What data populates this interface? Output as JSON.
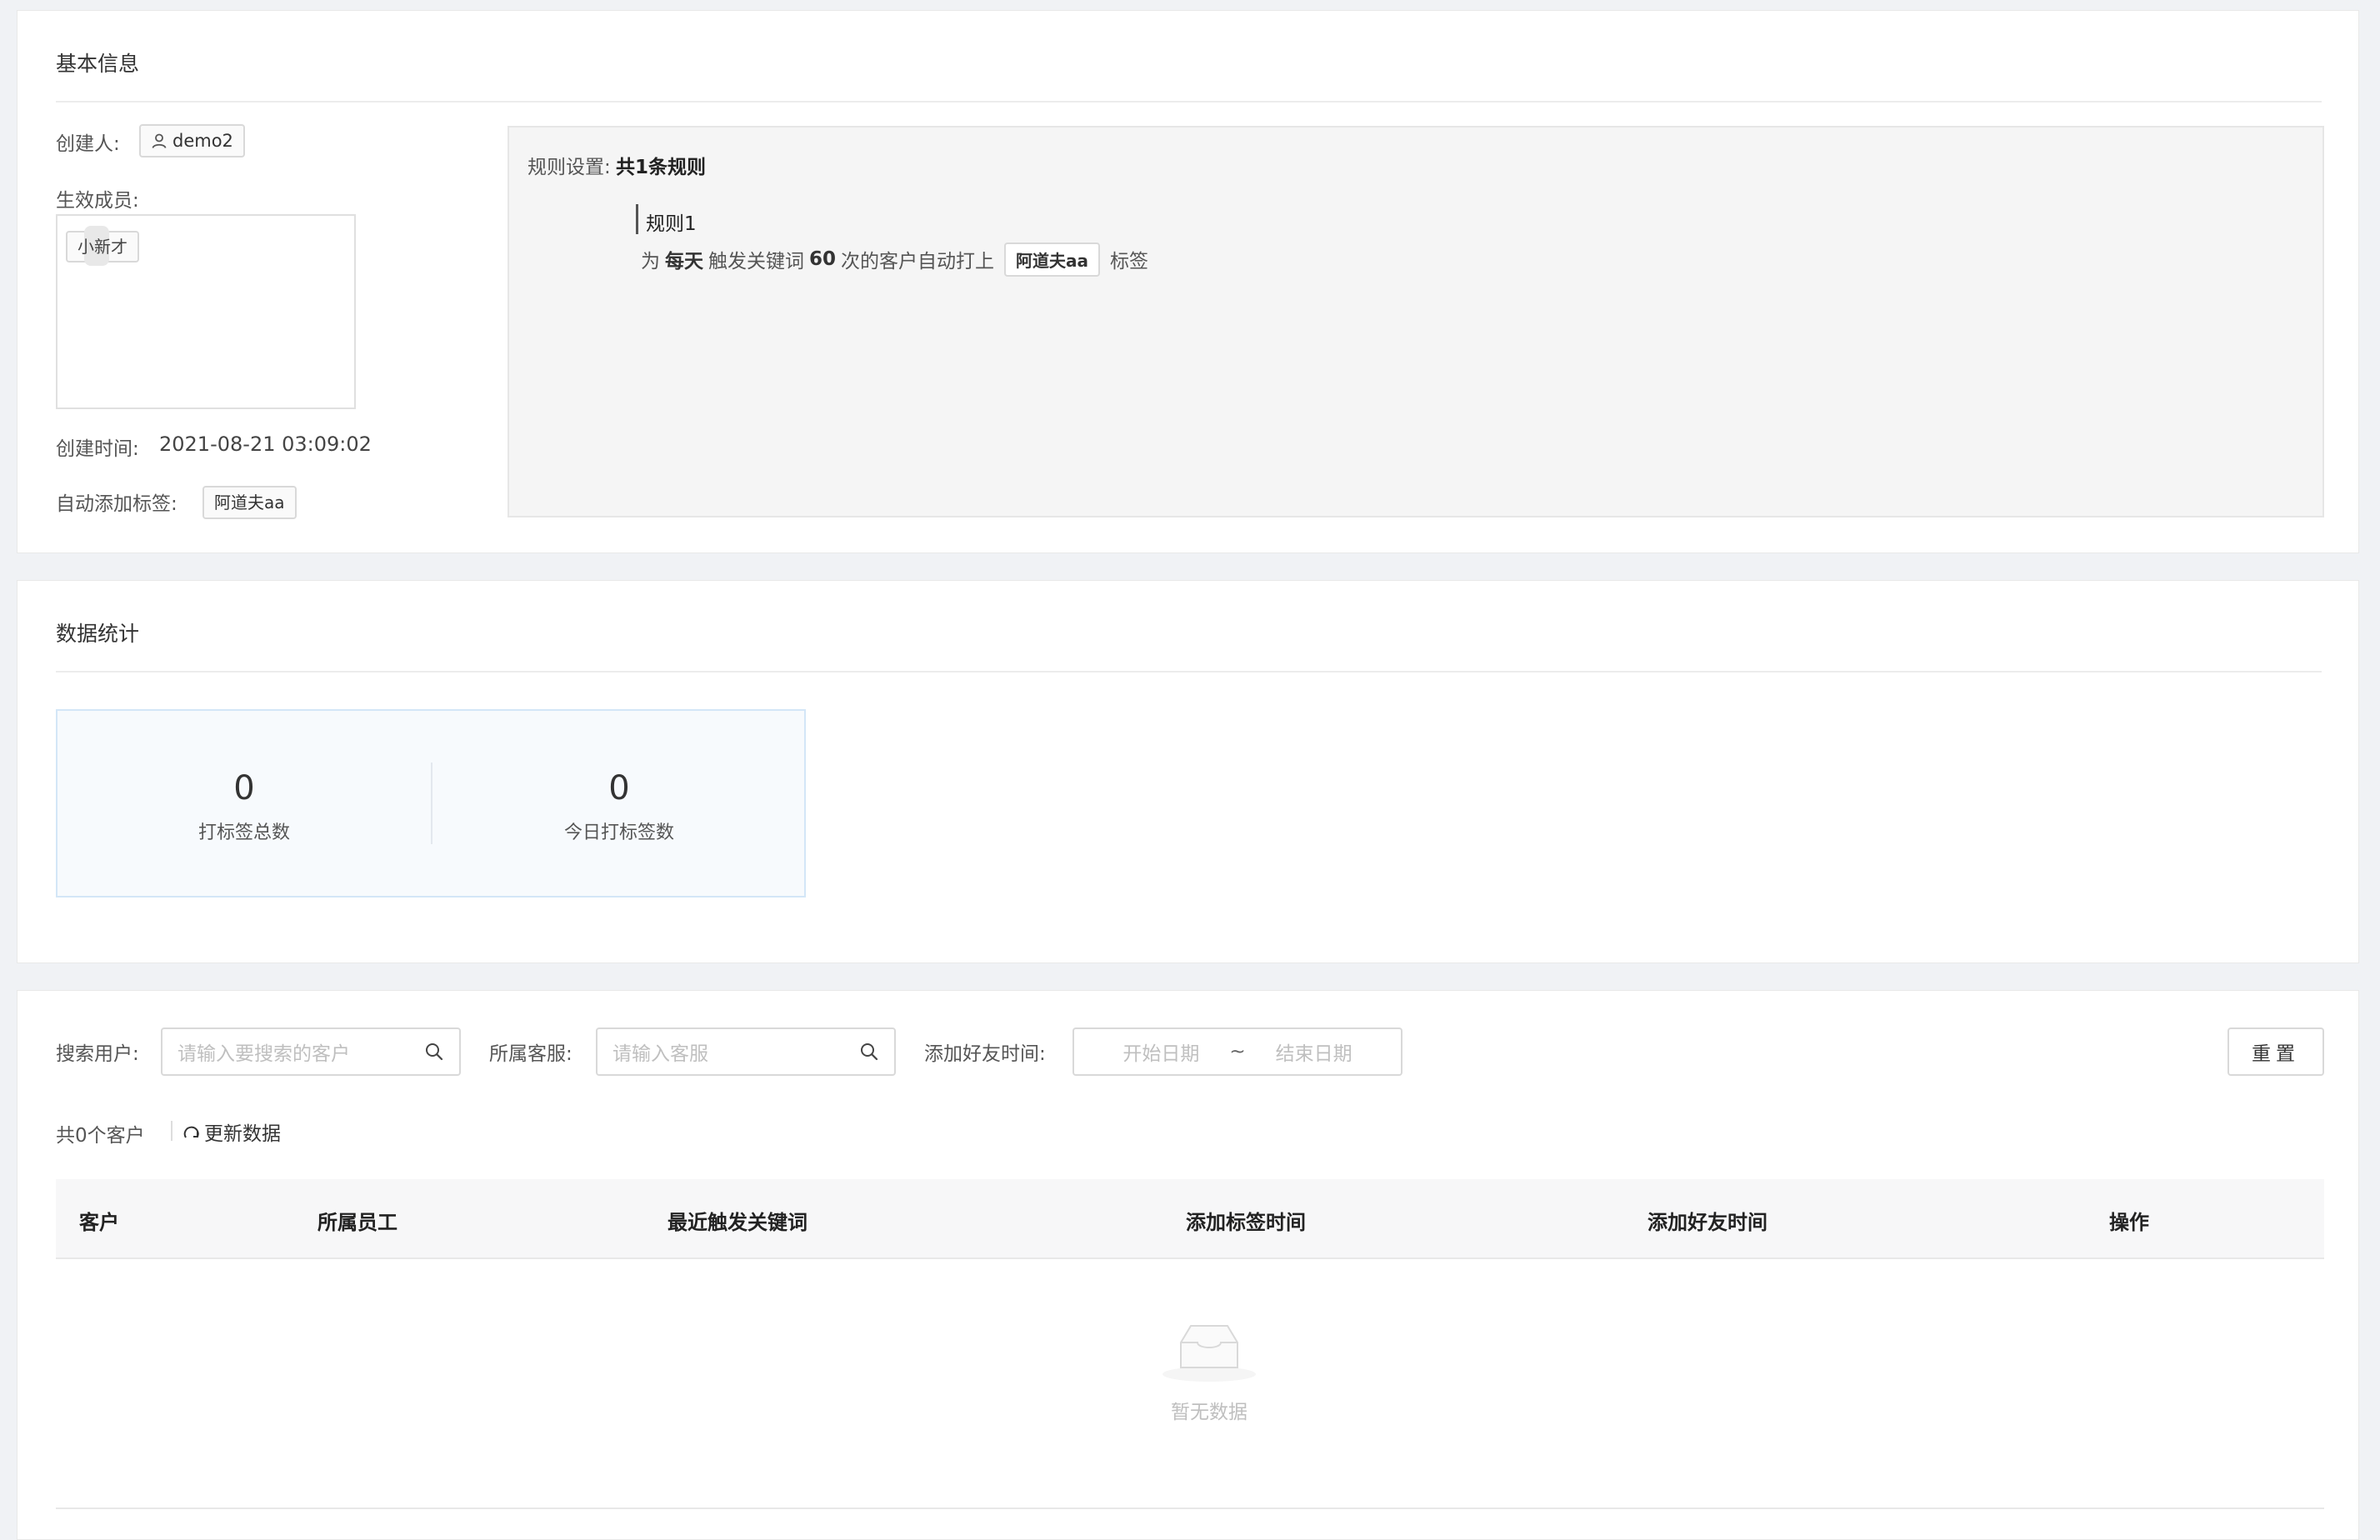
{
  "basic_info": {
    "title": "基本信息",
    "creator_label": "创建人:",
    "creator_name": "demo2",
    "members_label": "生效成员:",
    "member_tag": "小新才",
    "created_time_label": "创建时间:",
    "created_time_value": "2021-08-21 03:09:02",
    "auto_tag_label": "自动添加标签:",
    "auto_tag_value": "阿道夫aa",
    "rules_label": "规则设置:",
    "rules_count": "共1条规则",
    "rule_title": "规则1",
    "rule_text_prefix": "为",
    "rule_freq": "每天",
    "rule_text_mid": "触发关键词",
    "rule_count": "60",
    "rule_text_suffix": "次的客户自动打上",
    "rule_tag": "阿道夫aa",
    "rule_text_end": "标签"
  },
  "stats": {
    "title": "数据统计",
    "total_value": "0",
    "total_label": "打标签总数",
    "today_value": "0",
    "today_label": "今日打标签数"
  },
  "filters": {
    "search_user_label": "搜索用户:",
    "search_user_placeholder": "请输入要搜索的客户",
    "service_label": "所属客服:",
    "service_placeholder": "请输入客服",
    "add_time_label": "添加好友时间:",
    "start_date": "开始日期",
    "date_sep": "~",
    "end_date": "结束日期",
    "reset_button": "重置"
  },
  "summary": {
    "count_text": "共0个客户",
    "refresh_text": "更新数据"
  },
  "table": {
    "columns": [
      "客户",
      "所属员工",
      "最近触发关键词",
      "添加标签时间",
      "添加好友时间",
      "操作"
    ],
    "empty_text": "暂无数据"
  },
  "colors": {
    "page_bg": "#f0f2f5",
    "stats_bg": "#f7fafd",
    "stats_border": "#d3e6f7",
    "rules_bg": "#f5f5f5"
  }
}
